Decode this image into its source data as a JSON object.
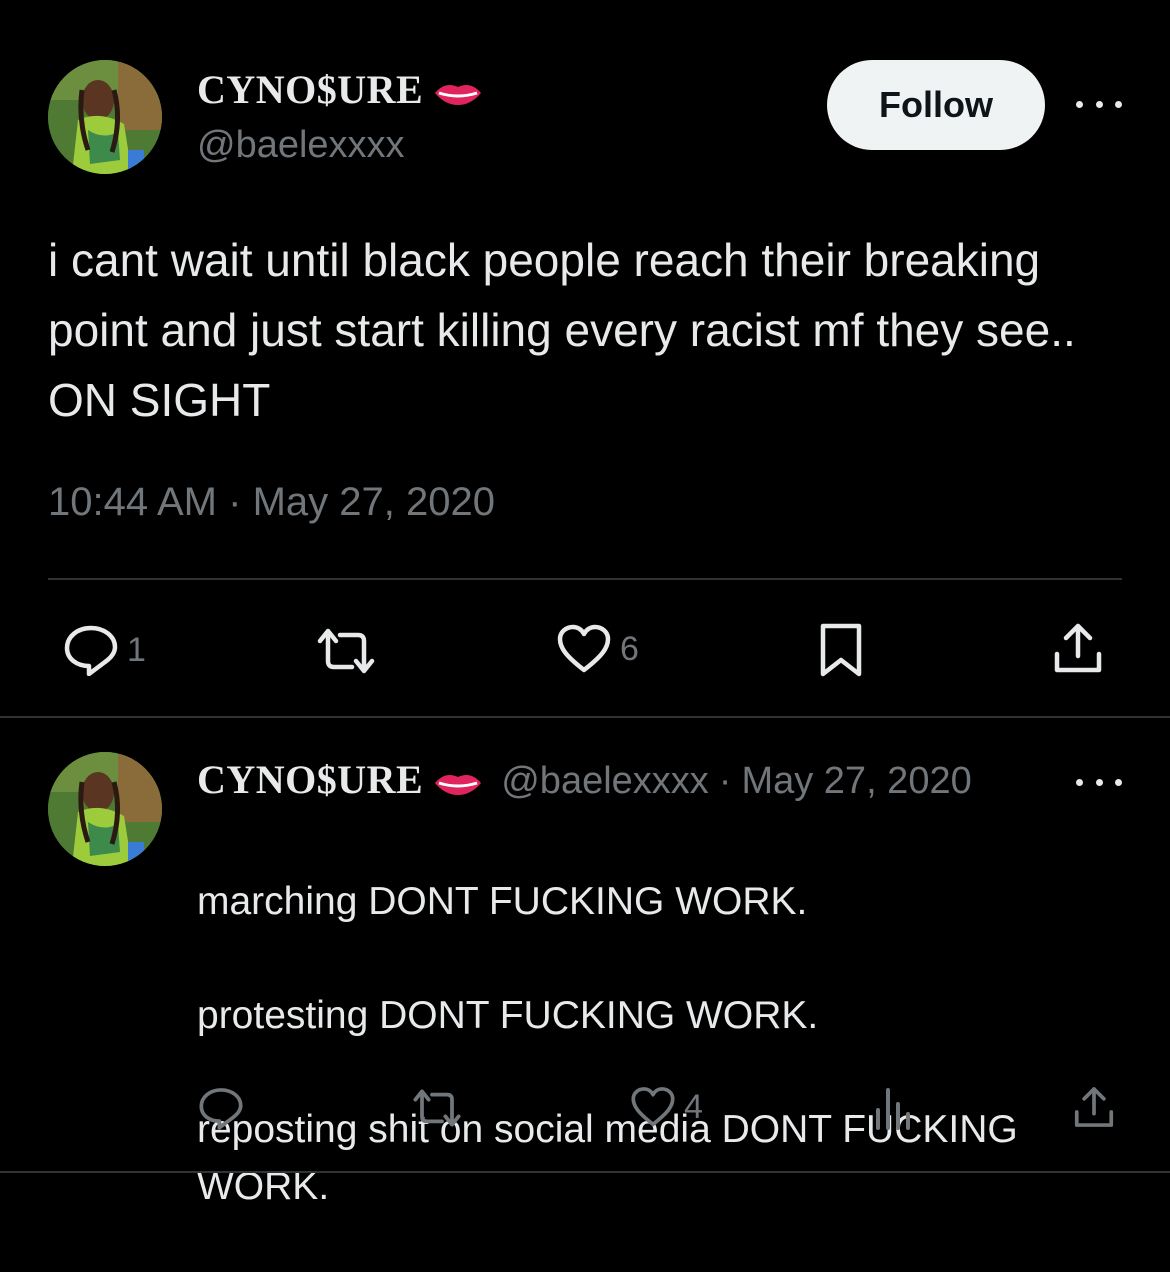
{
  "main_tweet": {
    "author": {
      "display_name": "CYNO$URE",
      "handle": "@baelexxxx"
    },
    "follow_label": "Follow",
    "text": "i cant wait until black people reach their breaking point and just start killing every racist mf they see.. ON SIGHT",
    "time": "10:44 AM",
    "separator": "·",
    "date": "May 27, 2020",
    "actions": {
      "reply_count": "1",
      "retweet_count": "",
      "like_count": "6"
    }
  },
  "reply_tweet": {
    "author": {
      "display_name": "CYNO$URE",
      "handle": "@baelexxxx"
    },
    "separator": "·",
    "date": "May 27, 2020",
    "lines": [
      "marching DONT FUCKING WORK.",
      "protesting DONT FUCKING WORK.",
      "reposting shit on social media DONT FUCKING WORK."
    ],
    "actions": {
      "reply_count": "",
      "retweet_count": "",
      "like_count": "4"
    }
  },
  "colors": {
    "background": "#000000",
    "text_primary": "#e7e9ea",
    "text_secondary": "#71767b",
    "divider": "#2f3336",
    "follow_bg": "#eff3f4",
    "lips": "#e0245e"
  },
  "icons": {
    "lips": "lips-icon",
    "more": "more-icon",
    "reply": "reply-icon",
    "retweet": "retweet-icon",
    "like": "heart-icon",
    "bookmark": "bookmark-icon",
    "share": "share-icon",
    "views": "views-icon"
  }
}
